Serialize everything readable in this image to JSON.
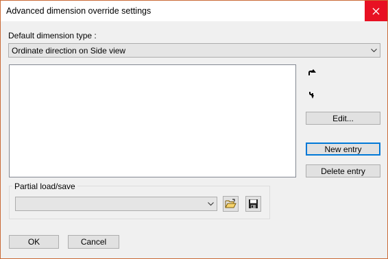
{
  "window": {
    "title": "Advanced dimension override settings",
    "close_label": "✕"
  },
  "default_type": {
    "label": "Default dimension type :",
    "selected": "Ordinate direction on Side view"
  },
  "entries": [],
  "buttons": {
    "move_up_icon": "arrow-up-turn-icon",
    "move_down_icon": "arrow-down-turn-icon",
    "edit": "Edit...",
    "new_entry": "New entry",
    "delete_entry": "Delete entry",
    "ok": "OK",
    "cancel": "Cancel"
  },
  "partial": {
    "label": "Partial load/save",
    "selected": "",
    "open_icon": "open-folder-icon",
    "save_icon": "floppy-disk-icon"
  },
  "colors": {
    "close_button": "#e81123",
    "default_button_border": "#0078d7",
    "window_border": "#c96a35"
  }
}
